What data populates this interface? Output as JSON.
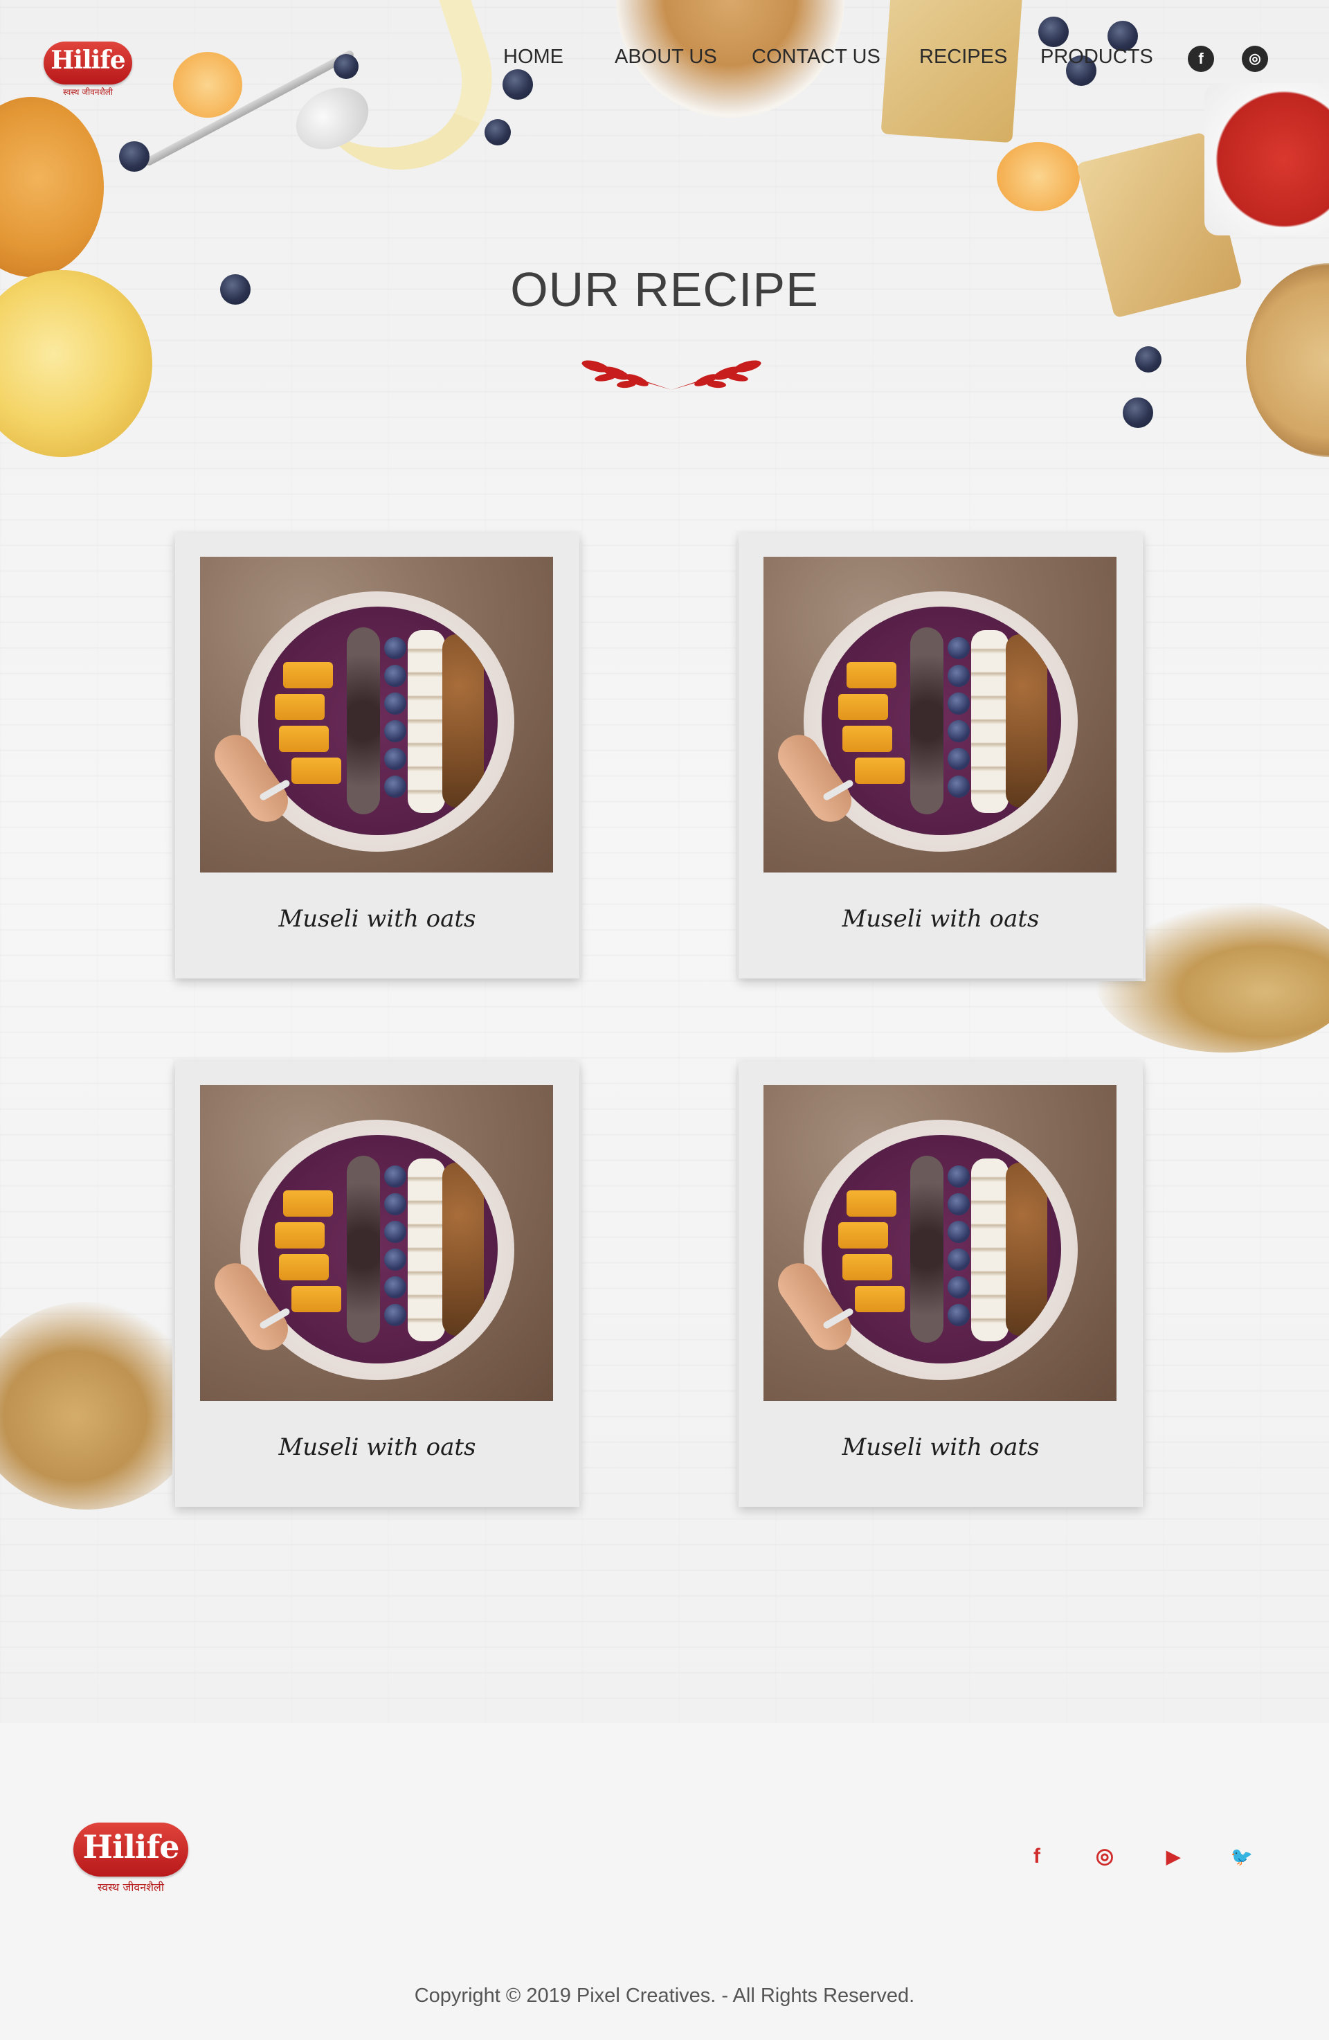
{
  "brand": {
    "logo_text": "Hilife",
    "logo_tagline": "स्वस्थ जीवनशैली"
  },
  "nav": {
    "items": [
      "HOME",
      "ABOUT US",
      "CONTACT US",
      "RECIPES",
      "PRODUCTS"
    ],
    "social": [
      {
        "icon": "facebook-icon",
        "glyph": "f"
      },
      {
        "icon": "instagram-icon",
        "glyph": "◎"
      }
    ]
  },
  "section": {
    "title": "OUR RECIPE"
  },
  "recipes": [
    {
      "label": "Museli with oats"
    },
    {
      "label": "Museli with oats"
    },
    {
      "label": "Museli with oats"
    },
    {
      "label": "Museli with oats"
    }
  ],
  "footer": {
    "social": [
      {
        "icon": "facebook-icon",
        "glyph": "f"
      },
      {
        "icon": "instagram-icon",
        "glyph": "◎"
      },
      {
        "icon": "youtube-icon",
        "glyph": "▶"
      },
      {
        "icon": "twitter-icon",
        "glyph": "🐦"
      }
    ],
    "copyright": "Copyright © 2019 Pixel Creatives. - All Rights Reserved."
  },
  "colors": {
    "brand_red": "#d02a2a",
    "text_dark": "#2a2a2a",
    "background": "#f3f3f3"
  }
}
